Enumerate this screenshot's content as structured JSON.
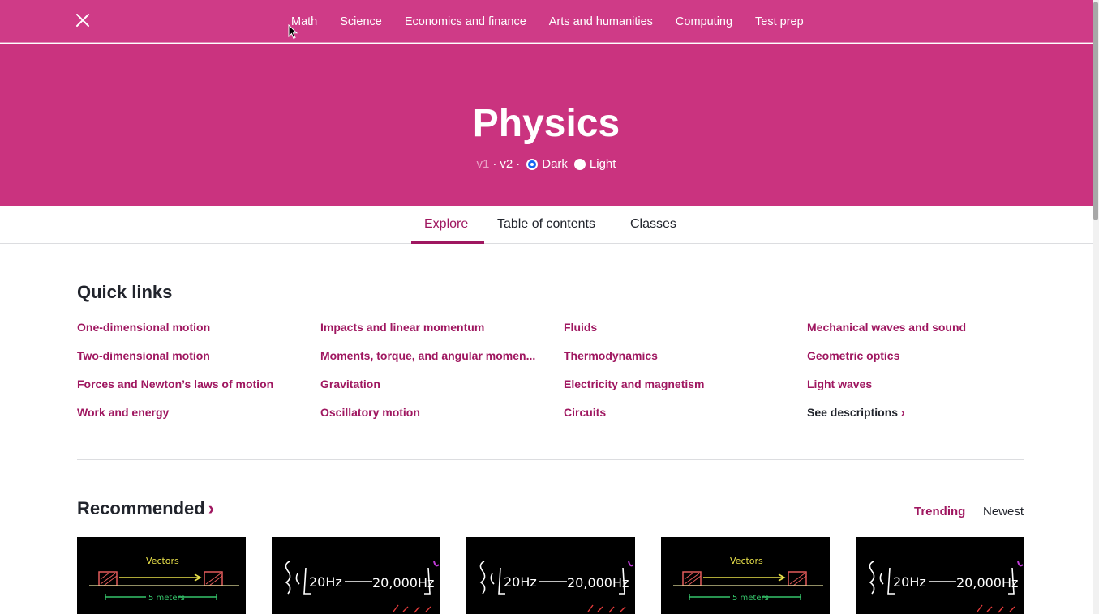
{
  "topbar": {
    "nav": [
      "Math",
      "Science",
      "Economics and finance",
      "Arts and humanities",
      "Computing",
      "Test prep"
    ]
  },
  "hero": {
    "title": "Physics",
    "version_v1": "v1",
    "version_v2": "v2",
    "separator": "·",
    "theme_dark": "Dark",
    "theme_light": "Light",
    "theme_selected": "Dark"
  },
  "tabs": [
    "Explore",
    "Table of contents",
    "Classes"
  ],
  "quick_links": {
    "title": "Quick links",
    "columns": [
      [
        "One-dimensional motion",
        "Two-dimensional motion",
        "Forces and Newton’s laws of motion",
        "Work and energy"
      ],
      [
        "Impacts and linear momentum",
        "Moments, torque, and angular momen...",
        "Gravitation",
        "Oscillatory motion"
      ],
      [
        "Fluids",
        "Thermodynamics",
        "Electricity and magnetism",
        "Circuits"
      ],
      [
        "Mechanical waves and sound",
        "Geometric optics",
        "Light waves"
      ]
    ],
    "see_descriptions": "See descriptions",
    "chevron": "›"
  },
  "recommended": {
    "title": "Recommended",
    "chevron": "›",
    "sort_trending": "Trending",
    "sort_newest": "Newest"
  },
  "thumbnails": [
    {
      "kind": "vectors",
      "text1": "Vectors",
      "text2": "5 meters"
    },
    {
      "kind": "hz",
      "text1": "20Hz",
      "text2": "20,000Hz"
    },
    {
      "kind": "hz",
      "text1": "20Hz",
      "text2": "20,000Hz"
    },
    {
      "kind": "vectors",
      "text1": "Vectors",
      "text2": "5 meters"
    },
    {
      "kind": "hz",
      "text1": "20Hz",
      "text2": "20,000Hz"
    }
  ],
  "colors": {
    "topbar": "#cf3b87",
    "hero": "#ca337f",
    "accent": "#9f1760",
    "radio_selected": "#1865f2"
  }
}
